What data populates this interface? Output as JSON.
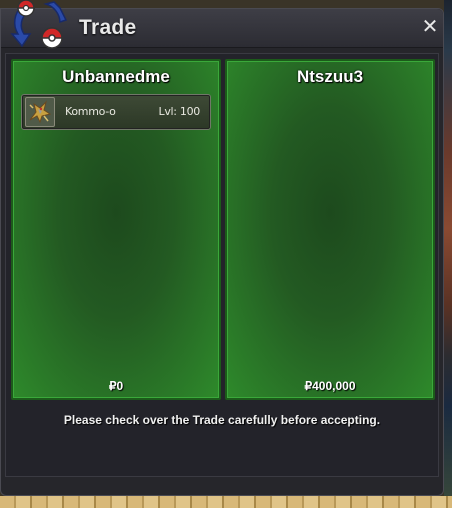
{
  "window": {
    "title": "Trade",
    "close_icon": "close-icon",
    "logo_icon": "trade-logo-icon"
  },
  "trade": {
    "left": {
      "player_name": "Unbannedme",
      "money": "₽0",
      "items": [
        {
          "name": "Kommo-o",
          "level": "Lvl: 100",
          "icon": "pokemon-sprite-icon"
        }
      ]
    },
    "right": {
      "player_name": "Ntszuu3",
      "money": "₽400,000",
      "items": []
    },
    "notice": "Please check over the Trade carefully before accepting."
  },
  "colors": {
    "panel_green": "#2e8a2b",
    "window_bg": "#26262b",
    "title_text": "#e9e9e9"
  }
}
